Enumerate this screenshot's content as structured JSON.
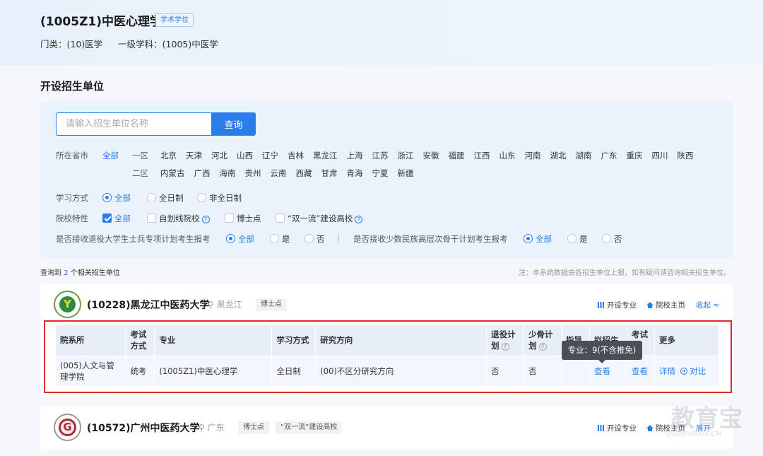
{
  "hero": {
    "title": "(1005Z1)中医心理学",
    "badge": "学术学位",
    "category": "门类：(10)医学",
    "discipline": "一级学科：(1005)中医学"
  },
  "section_title": "开设招生单位",
  "search": {
    "placeholder": "请输入招生单位名称",
    "button": "查询"
  },
  "filters": {
    "province": {
      "label": "所在省市",
      "all": "全部",
      "region1": "一区",
      "region1_list": [
        "北京",
        "天津",
        "河北",
        "山西",
        "辽宁",
        "吉林",
        "黑龙江",
        "上海",
        "江苏",
        "浙江",
        "安徽",
        "福建",
        "江西",
        "山东",
        "河南",
        "湖北",
        "湖南",
        "广东",
        "重庆",
        "四川",
        "陕西"
      ],
      "region2": "二区",
      "region2_list": [
        "内蒙古",
        "广西",
        "海南",
        "贵州",
        "云南",
        "西藏",
        "甘肃",
        "青海",
        "宁夏",
        "新疆"
      ]
    },
    "study_mode": {
      "label": "学习方式",
      "options": [
        "全部",
        "全日制",
        "非全日制"
      ],
      "selected": "全部"
    },
    "school_type": {
      "label": "院校特性",
      "options": [
        "全部",
        "自划线院校",
        "博士点",
        "“双一流”建设高校"
      ],
      "checked": "全部"
    },
    "veteran": {
      "label": "是否接收退役大学生士兵专项计划考生报考",
      "options": [
        "全部",
        "是",
        "否"
      ],
      "selected": "全部"
    },
    "minority": {
      "label": "是否接收少数民族高层次骨干计划考生报考",
      "options": [
        "全部",
        "是",
        "否"
      ],
      "selected": "全部"
    }
  },
  "result": {
    "prefix": "查询到",
    "count": "2",
    "suffix": "个相关招生单位",
    "note": "注：本系统数据由各招生单位上报，如有疑问请咨询相关招生单位。"
  },
  "universities": [
    {
      "name": "(10228)黑龙江中医药大学",
      "location": "黑龙江",
      "tags": [
        "博士点"
      ],
      "actions": {
        "majors": "开设专业",
        "home": "院校主页",
        "toggle": "收起 ≈"
      }
    },
    {
      "name": "(10572)广州中医药大学",
      "location": "广东",
      "tags": [
        "博士点",
        "“双一流”建设高校"
      ],
      "actions": {
        "majors": "开设专业",
        "home": "院校主页",
        "toggle": "展开"
      }
    }
  ],
  "major_table": {
    "headers": [
      "院系所",
      "考试方式",
      "专业",
      "学习方式",
      "研究方向",
      "退役计划",
      "少骨计划",
      "指导",
      "拟招生",
      "考试目",
      "更多"
    ],
    "row": {
      "dept": "(005)人文与管理学院",
      "exam_mode": "统考",
      "major": "(1005Z1)中医心理学",
      "study_mode": "全日制",
      "direction": "(00)不区分研究方向",
      "veteran": "否",
      "minority": "否",
      "advisor": "",
      "enroll": "查看",
      "subjects": "查看",
      "detail": "详情",
      "compare": "对比"
    }
  },
  "tooltip": "专业：9(不含推免)",
  "watermark": {
    "cn": "教育宝",
    "en": "JIAOYUBAO.CN"
  }
}
